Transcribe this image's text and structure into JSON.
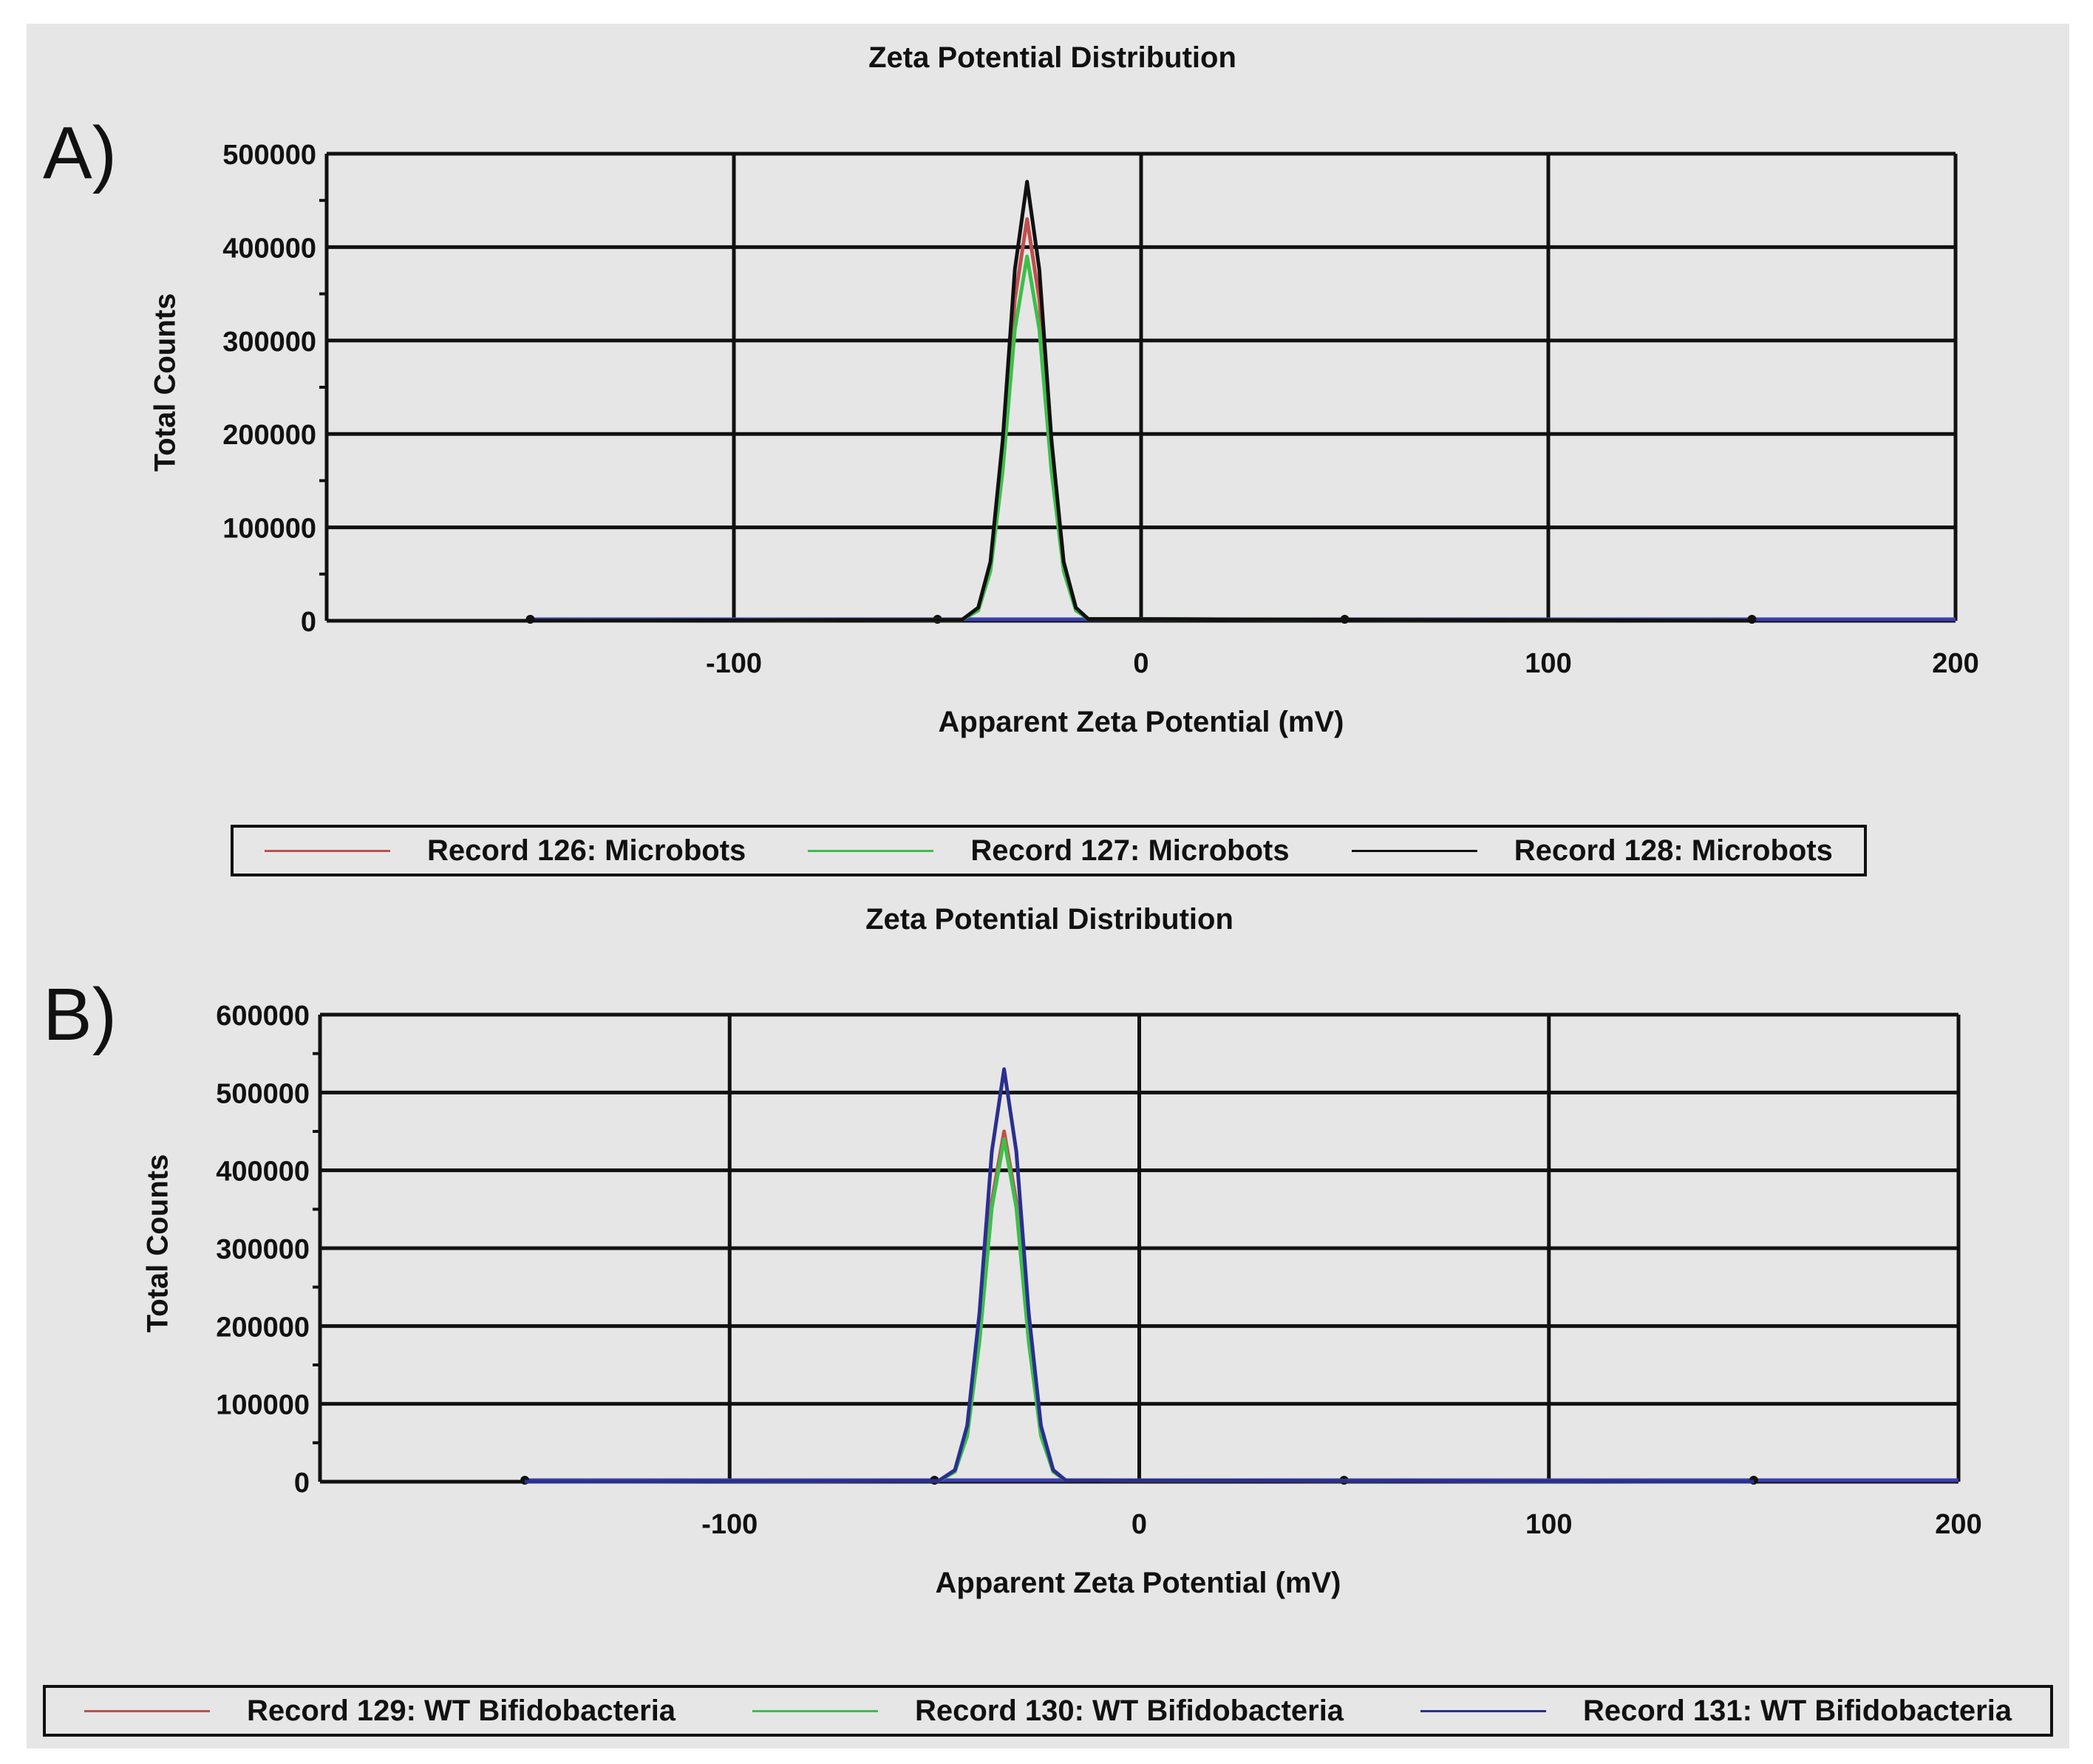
{
  "chart_data": [
    {
      "type": "line",
      "panel_label": "A)",
      "title": "Zeta Potential Distribution",
      "xlabel": "Apparent Zeta Potential (mV)",
      "ylabel": "Total Counts",
      "xlim": [
        -200,
        200
      ],
      "ylim": [
        0,
        500000
      ],
      "xticks": [
        "-100",
        "0",
        "100",
        "200"
      ],
      "xtick_values": [
        -100,
        0,
        100,
        200
      ],
      "yticks": [
        "0",
        "100000",
        "200000",
        "300000",
        "400000",
        "500000"
      ],
      "ytick_values": [
        0,
        100000,
        200000,
        300000,
        400000,
        500000
      ],
      "grid": true,
      "legend_position": "bottom",
      "baseline_range": [
        -150,
        150
      ],
      "x": [
        -44,
        -40,
        -37,
        -34,
        -31,
        -28,
        -25,
        -22,
        -19,
        -16,
        -13
      ],
      "series": [
        {
          "name": "Record 126: Microbots",
          "color": "#c0504d",
          "values": [
            1000,
            12000,
            58000,
            176000,
            344000,
            430000,
            344000,
            176000,
            58000,
            12000,
            2000
          ]
        },
        {
          "name": "Record 127: Microbots",
          "color": "#3cbf4a",
          "values": [
            1000,
            11000,
            53000,
            160000,
            312000,
            390000,
            312000,
            160000,
            53000,
            11000,
            2000
          ]
        },
        {
          "name": "Record 128: Microbots",
          "color": "#111111",
          "values": [
            1000,
            14000,
            63000,
            193000,
            376000,
            470000,
            376000,
            193000,
            63000,
            14000,
            2000
          ]
        }
      ]
    },
    {
      "type": "line",
      "panel_label": "B)",
      "title": "Zeta Potential Distribution",
      "xlabel": "Apparent Zeta Potential (mV)",
      "ylabel": "Total Counts",
      "xlim": [
        -200,
        200
      ],
      "ylim": [
        0,
        600000
      ],
      "xticks": [
        "-100",
        "0",
        "100",
        "200"
      ],
      "xtick_values": [
        -100,
        0,
        100,
        200
      ],
      "yticks": [
        "0",
        "100000",
        "200000",
        "300000",
        "400000",
        "500000",
        "600000"
      ],
      "ytick_values": [
        0,
        100000,
        200000,
        300000,
        400000,
        500000,
        600000
      ],
      "grid": true,
      "legend_position": "bottom",
      "baseline_range": [
        -150,
        150
      ],
      "x": [
        -49,
        -45,
        -42,
        -39,
        -36,
        -33,
        -30,
        -27,
        -24,
        -21,
        -18
      ],
      "series": [
        {
          "name": "Record 129: WT Bifidobacteria",
          "color": "#c0504d",
          "values": [
            1000,
            13000,
            61000,
            185000,
            360000,
            450000,
            360000,
            185000,
            61000,
            13000,
            2000
          ]
        },
        {
          "name": "Record 130: WT Bifidobacteria",
          "color": "#3cbf4a",
          "values": [
            1000,
            13000,
            59000,
            180000,
            352000,
            440000,
            352000,
            180000,
            59000,
            13000,
            2000
          ]
        },
        {
          "name": "Record 131: WT Bifidobacteria",
          "color": "#2b2f8f",
          "values": [
            1000,
            15000,
            72000,
            217000,
            424000,
            530000,
            424000,
            217000,
            72000,
            15000,
            2000
          ]
        }
      ]
    }
  ]
}
